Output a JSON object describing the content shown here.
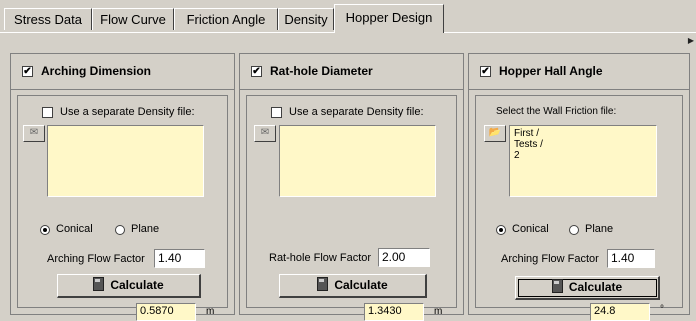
{
  "tabs": [
    {
      "label": "Stress Data",
      "active": false
    },
    {
      "label": "Flow Curve",
      "active": false
    },
    {
      "label": "Friction Angle",
      "active": false
    },
    {
      "label": "Density",
      "active": false
    },
    {
      "label": "Hopper Design",
      "active": true
    }
  ],
  "panels": [
    {
      "title": "Arching Dimension",
      "checked": true,
      "use_density_label": "Use a separate Density file:",
      "use_density_checked": false,
      "file_lines": [],
      "radio_conical": "Conical",
      "radio_plane": "Plane",
      "selected_radio": "Conical",
      "factor_label": "Arching Flow Factor",
      "factor_value": "1.40",
      "calculate_label": "Calculate",
      "result_value": "0.5870",
      "result_unit": "m"
    },
    {
      "title": "Rat-hole Diameter",
      "checked": true,
      "use_density_label": "Use a separate Density file:",
      "use_density_checked": false,
      "file_lines": [],
      "factor_label": "Rat-hole Flow Factor",
      "factor_value": "2.00",
      "calculate_label": "Calculate",
      "result_value": "1.3430",
      "result_unit": "m"
    },
    {
      "title": "Hopper Hall Angle",
      "checked": true,
      "select_label": "Select the Wall Friction file:",
      "file_lines": [
        "First /",
        "Tests /",
        "2"
      ],
      "radio_conical": "Conical",
      "radio_plane": "Plane",
      "selected_radio": "Conical",
      "factor_label": "Arching Flow Factor",
      "factor_value": "1.40",
      "calculate_label": "Calculate",
      "result_value": "24.8",
      "result_unit": "°"
    }
  ],
  "icons": {
    "checkbox_mark": "✔",
    "open_folder": "open-folder-icon",
    "calculator": "calculator-icon"
  },
  "colors": {
    "window_bg": "#d4d0c8",
    "field_bg": "#fff8c8"
  }
}
